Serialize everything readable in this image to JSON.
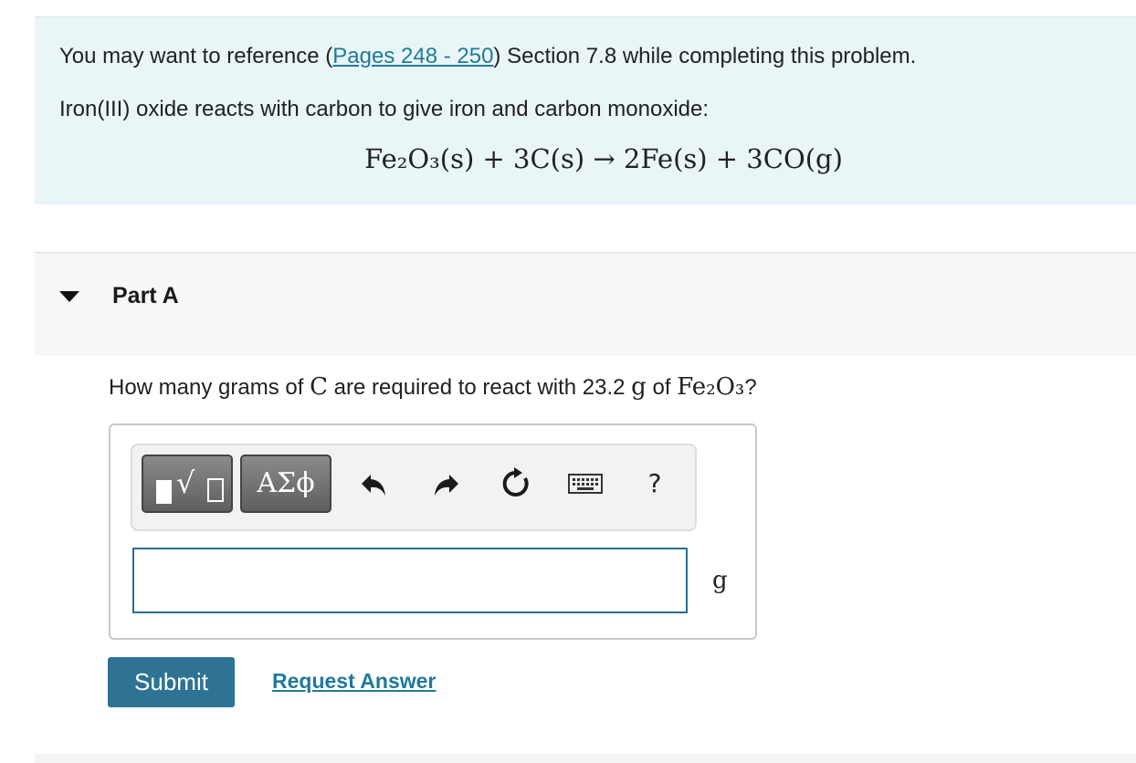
{
  "intro": {
    "reference_prefix": "You may want to reference (",
    "reference_link": "Pages 248 - 250",
    "reference_suffix": ") Section 7.8 while completing this problem.",
    "description": "Iron(III) oxide reacts with carbon to give iron and carbon monoxide:",
    "equation": "Fe₂O₃(s) + 3C(s) → 2Fe(s) + 3CO(g)"
  },
  "part": {
    "title": "Part A"
  },
  "question": {
    "prefix": "How many grams of ",
    "element": "C",
    "middle": " are required to react with 23.2 ",
    "mass_unit": "g",
    "of": " of ",
    "compound": "Fe₂O₃",
    "suffix": "?"
  },
  "toolbar": {
    "greek_label": "ΑΣϕ",
    "help_label": "?"
  },
  "answer": {
    "value": "",
    "unit": "g"
  },
  "actions": {
    "submit_label": "Submit",
    "request_label": "Request Answer"
  },
  "colors": {
    "accent": "#2e7394",
    "link": "#1f7a9a",
    "intro_bg": "#eaf5f7"
  }
}
